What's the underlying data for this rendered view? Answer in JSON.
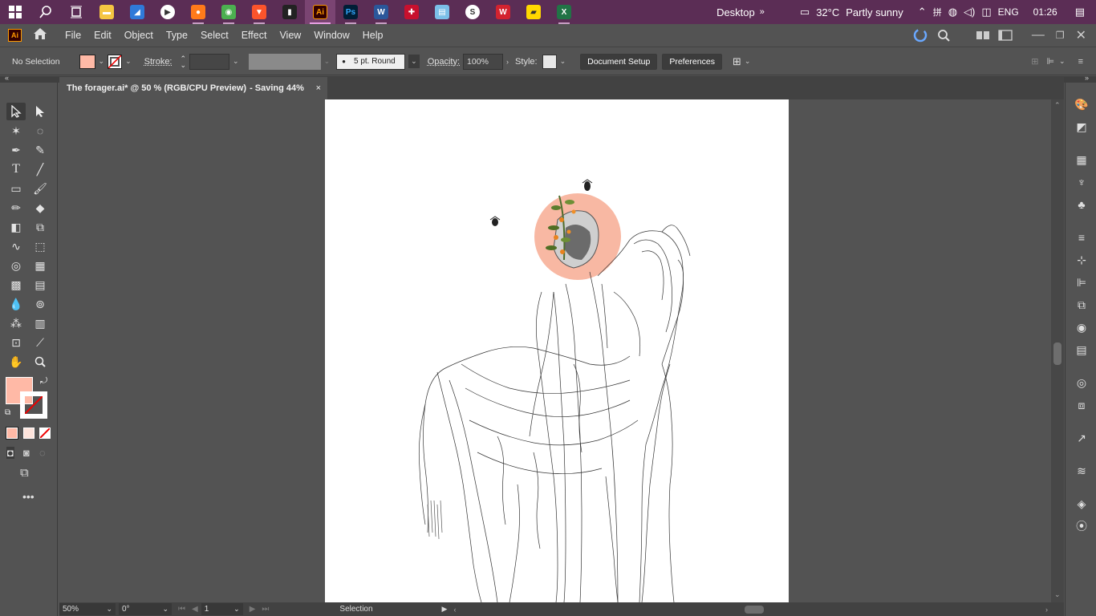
{
  "taskbar": {
    "apps": [
      {
        "name": "file-explorer",
        "color": "#f5c542",
        "glyph": "▬"
      },
      {
        "name": "photos",
        "color": "#2f7ad9",
        "glyph": "◢"
      },
      {
        "name": "media-player",
        "color": "#ffffff",
        "glyph": "▶"
      },
      {
        "name": "firefox",
        "color": "#ff7a1a",
        "glyph": "●"
      },
      {
        "name": "chrome",
        "color": "#4caf50",
        "glyph": "◉"
      },
      {
        "name": "brave",
        "color": "#fb542b",
        "glyph": "▼"
      },
      {
        "name": "app-bars",
        "color": "#222222",
        "glyph": "▮"
      },
      {
        "name": "illustrator",
        "color": "#330000",
        "glyph": "Ai"
      },
      {
        "name": "photoshop",
        "color": "#001e36",
        "glyph": "Ps"
      },
      {
        "name": "word",
        "color": "#2b579a",
        "glyph": "W"
      },
      {
        "name": "language",
        "color": "#c8102e",
        "glyph": "✚"
      },
      {
        "name": "notepad",
        "color": "#7bbfe8",
        "glyph": "▤"
      },
      {
        "name": "app-s",
        "color": "#ffffff",
        "glyph": "S"
      },
      {
        "name": "wps",
        "color": "#d3232f",
        "glyph": "W"
      },
      {
        "name": "sticky-notes",
        "color": "#ffd800",
        "glyph": "▰"
      },
      {
        "name": "excel",
        "color": "#217346",
        "glyph": "X"
      }
    ],
    "desktop_label": "Desktop",
    "weather_temp": "32°C",
    "weather_desc": "Partly sunny",
    "lang": "ENG",
    "time": "01:26"
  },
  "menu": {
    "logo": "Ai",
    "items": [
      "File",
      "Edit",
      "Object",
      "Type",
      "Select",
      "Effect",
      "View",
      "Window",
      "Help"
    ]
  },
  "control": {
    "selection": "No Selection",
    "stroke_label": "Stroke:",
    "brush": "5 pt. Round",
    "opacity_label": "Opacity:",
    "opacity_value": "100%",
    "style_label": "Style:",
    "doc_setup": "Document Setup",
    "preferences": "Preferences",
    "fill_color": "#ffb9a6"
  },
  "document": {
    "tab_title": "The forager.ai* @ 50 % (RGB/CPU Preview)",
    "saving": " - Saving 44%",
    "close": "×"
  },
  "status": {
    "zoom": "50%",
    "rotation": "0°",
    "artboard": "1",
    "tool": "Selection"
  },
  "artwork": {
    "circle_color": "#f8b8a3"
  }
}
